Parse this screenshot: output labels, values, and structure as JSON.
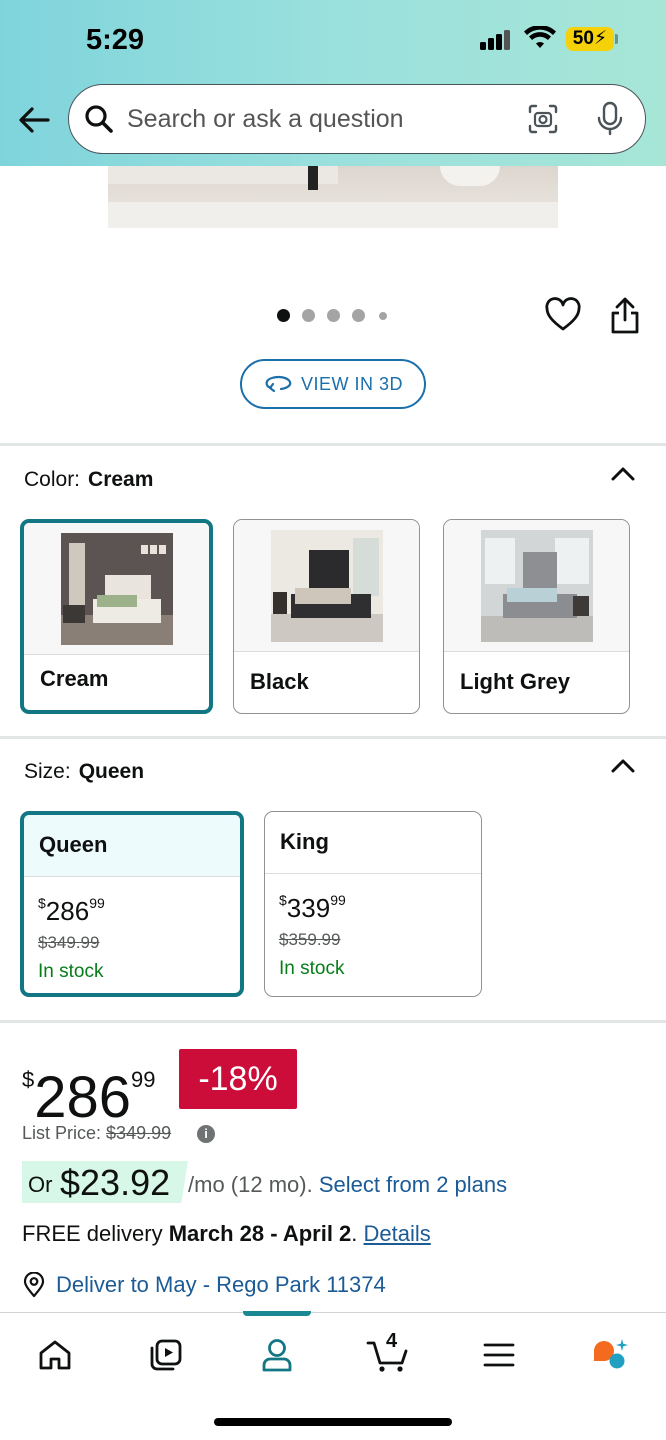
{
  "status_bar": {
    "time": "5:29",
    "battery": "50"
  },
  "search": {
    "placeholder": "Search or ask a question"
  },
  "gallery": {
    "view_3d_label": "VIEW IN 3D"
  },
  "color": {
    "label": "Color:",
    "selected": "Cream",
    "options": [
      {
        "name": "Cream"
      },
      {
        "name": "Black"
      },
      {
        "name": "Light Grey"
      }
    ]
  },
  "size": {
    "label": "Size:",
    "selected": "Queen",
    "options": [
      {
        "name": "Queen",
        "price_whole": "286",
        "price_cents": "99",
        "currency": "$",
        "list_price": "$349.99",
        "stock": "In stock"
      },
      {
        "name": "King",
        "price_whole": "339",
        "price_cents": "99",
        "currency": "$",
        "list_price": "$359.99",
        "stock": "In stock"
      }
    ]
  },
  "pricing": {
    "currency": "$",
    "whole": "286",
    "cents": "99",
    "discount": "-18%",
    "list_price_label": "List Price:",
    "list_price": "$349.99",
    "info": "i",
    "monthly_prefix": "Or",
    "monthly_amount": "$23.92",
    "monthly_suffix": "/mo (12 mo).",
    "plans_link": "Select from 2 plans"
  },
  "delivery": {
    "prefix": "FREE delivery",
    "dates": "March 28 - April 2",
    "period": ".",
    "details_link": "Details"
  },
  "location": {
    "text": "Deliver to May - Rego Park 11374"
  },
  "bottom_nav": {
    "cart_count": "4",
    "active": "account"
  },
  "colors": {
    "accent": "#127683",
    "link": "#1c5b95",
    "deal": "#cc0c39",
    "in_stock": "#067d18"
  }
}
